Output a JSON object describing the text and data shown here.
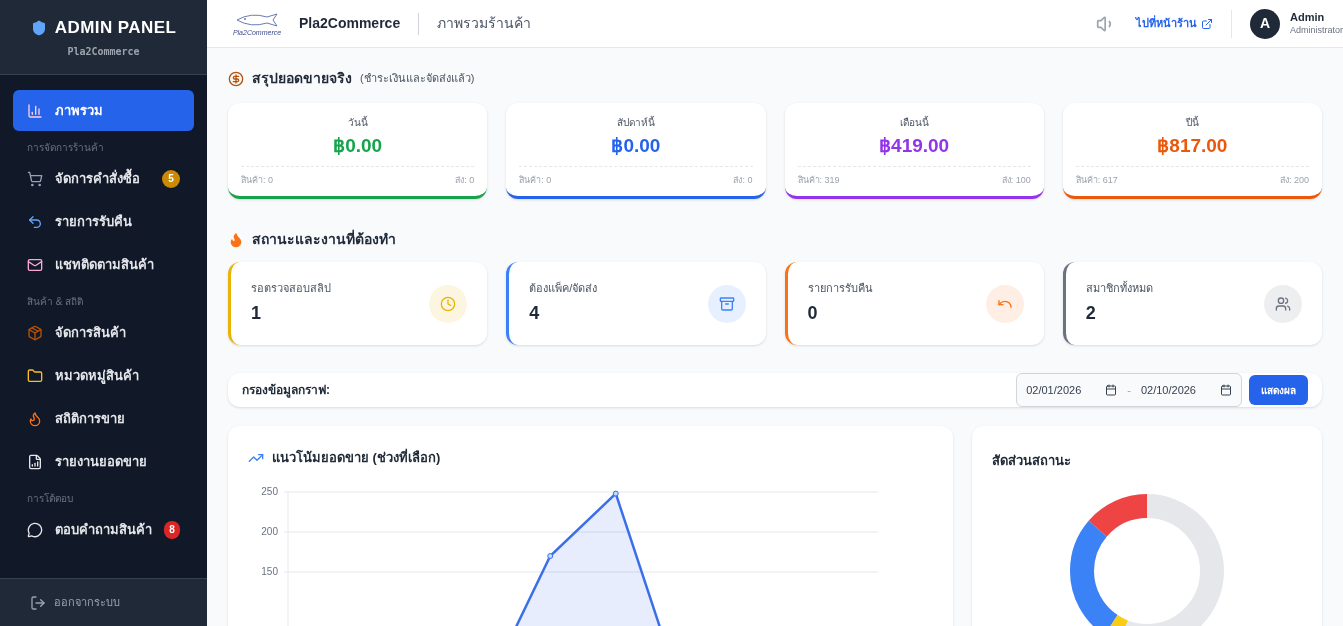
{
  "sidebar": {
    "title": "ADMIN PANEL",
    "subtitle": "Pla2Commerce",
    "items": [
      {
        "kind": "item",
        "label": "ภาพรวม",
        "selected": true
      },
      {
        "kind": "section",
        "label": "การจัดการร้านค้า"
      },
      {
        "kind": "item",
        "label": "จัดการคำสั่งซื้อ",
        "selected": false,
        "badge": "5",
        "color": "#ca8a04"
      },
      {
        "kind": "item",
        "label": "รายการรับคืน",
        "selected": false
      },
      {
        "kind": "item",
        "label": "แชทติดตามสินค้า",
        "selected": false
      },
      {
        "kind": "section",
        "label": "สินค้า & สถิติ"
      },
      {
        "kind": "item",
        "label": "จัดการสินค้า",
        "selected": false
      },
      {
        "kind": "item",
        "label": "หมวดหมู่สินค้า",
        "selected": false
      },
      {
        "kind": "item",
        "label": "สถิติการขาย",
        "selected": false
      },
      {
        "kind": "item",
        "label": "รายงานยอดขาย",
        "selected": false
      },
      {
        "kind": "section",
        "label": "การโต้ตอบ"
      },
      {
        "kind": "item",
        "label": "ตอบคำถามสินค้า",
        "selected": false,
        "badge": "8",
        "color": "#dc2626"
      }
    ],
    "logout": "ออกจากระบบ"
  },
  "header": {
    "logo_text": "Pla2Commerce",
    "brand": "Pla2Commerce",
    "page_title": "ภาพรวมร้านค้า",
    "store_link": "ไปที่หน้าร้าน",
    "avatar": "A",
    "user_name": "Admin",
    "user_role": "Administrator"
  },
  "sales_summary": {
    "title": "สรุปยอดขายจริง",
    "note": "(ชำระเงินและจัดส่งแล้ว)",
    "cards": [
      {
        "label": "วันนี้",
        "amount": "฿0.00",
        "products": "สินค้า: 0",
        "shipping": "ส่ง: 0",
        "color": "#16a34a"
      },
      {
        "label": "สัปดาห์นี้",
        "amount": "฿0.00",
        "products": "สินค้า: 0",
        "shipping": "ส่ง: 0",
        "color": "#2563eb"
      },
      {
        "label": "เดือนนี้",
        "amount": "฿419.00",
        "products": "สินค้า: 319",
        "shipping": "ส่ง: 100",
        "color": "#9333ea"
      },
      {
        "label": "ปีนี้",
        "amount": "฿817.00",
        "products": "สินค้า: 617",
        "shipping": "ส่ง: 200",
        "color": "#ea580c"
      }
    ]
  },
  "tasks": {
    "title": "สถานะและงานที่ต้องทำ",
    "cards": [
      {
        "label": "รอตรวจสอบสลิป",
        "value": "1",
        "color": "#eab308"
      },
      {
        "label": "ต้องแพ็ค/จัดส่ง",
        "value": "4",
        "color": "#3b82f6"
      },
      {
        "label": "รายการรับคืน",
        "value": "0",
        "color": "#f97316"
      },
      {
        "label": "สมาชิกทั้งหมด",
        "value": "2",
        "color": "#6b7280"
      }
    ]
  },
  "filter": {
    "label": "กรองข้อมูลกราฟ:",
    "date_from": "02/01/2026",
    "separator": "-",
    "date_to": "02/10/2026",
    "button": "แสดงผล"
  },
  "trend_chart": {
    "title": "แนวโน้มยอดขาย (ช่วงที่เลือก)",
    "chart_data": {
      "type": "area",
      "ylim": [
        0,
        250
      ],
      "yticks": [
        150,
        200,
        250
      ],
      "series": [
        {
          "color": "#3b6fe8",
          "values": [
            0,
            0,
            0,
            0,
            170,
            248,
            0,
            0,
            0,
            0
          ]
        }
      ]
    }
  },
  "status_chart": {
    "title": "สัดส่วนสถานะ"
  }
}
